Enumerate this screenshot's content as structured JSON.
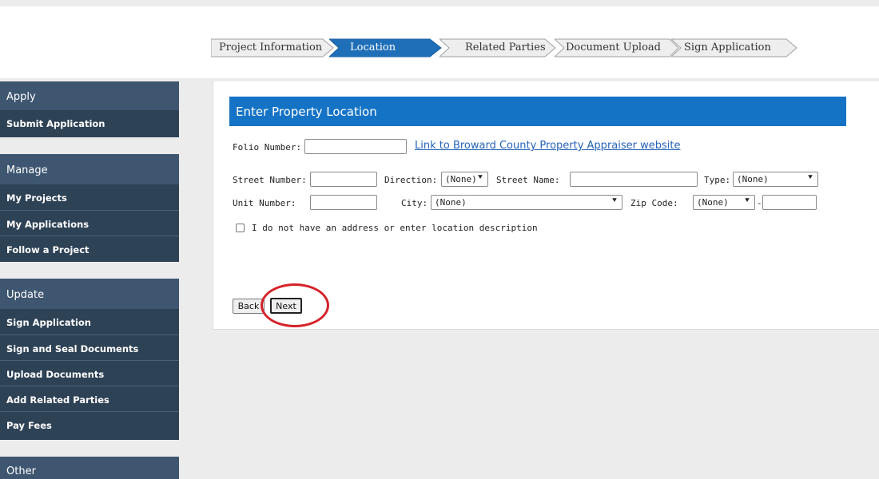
{
  "wizard": {
    "steps": [
      {
        "label": "Project Information",
        "state": "done"
      },
      {
        "label": "Location",
        "state": "active"
      },
      {
        "label": "Related Parties",
        "state": "upcoming"
      },
      {
        "label": "Document Upload",
        "state": "upcoming"
      },
      {
        "label": "Sign Application",
        "state": "upcoming"
      }
    ]
  },
  "sidebar": {
    "apply": {
      "title": "Apply",
      "items": [
        "Submit Application"
      ]
    },
    "manage": {
      "title": "Manage",
      "items": [
        "My Projects",
        "My Applications",
        "Follow a Project"
      ]
    },
    "update": {
      "title": "Update",
      "items": [
        "Sign Application",
        "Sign and Seal Documents",
        "Upload Documents",
        "Add Related Parties",
        "Pay Fees"
      ]
    },
    "other": {
      "title": "Other"
    }
  },
  "form": {
    "title": "Enter Property Location",
    "folio_label": "Folio Number:",
    "folio_value": "",
    "appraiser_link": "Link to Broward County Property Appraiser website",
    "street_number_label": "Street Number:",
    "direction_label": "Direction:",
    "direction_value": "(None)",
    "street_name_label": "Street Name:",
    "type_label": "Type:",
    "type_value": "(None)",
    "unit_number_label": "Unit Number:",
    "city_label": "City:",
    "city_value": "(None)",
    "zip_label": "Zip Code:",
    "zip_value": "(None)",
    "zip_separator": "-",
    "no_address_label": "I do not have an address or enter location description",
    "no_address_checked": false
  },
  "buttons": {
    "back": "Back",
    "next": "Next"
  },
  "colors": {
    "panel_header": "#1573c5",
    "sidebar_bg": "#2e4256",
    "sidebar_header": "#3e5670",
    "active_step": "#1f6fb8",
    "highlight_ring": "#d6232a",
    "link": "#2563b8"
  }
}
